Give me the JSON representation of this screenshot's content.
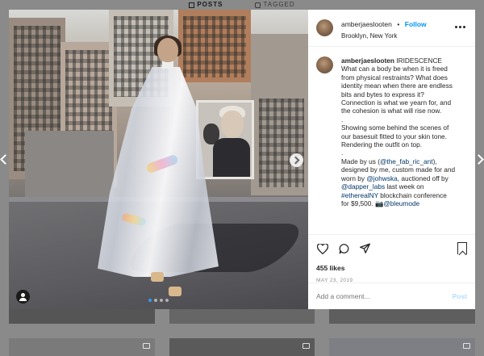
{
  "profile_tabs": [
    {
      "label": "POSTS",
      "icon": "grid-icon",
      "active": true
    },
    {
      "label": "TAGGED",
      "icon": "tagged-icon",
      "active": false
    }
  ],
  "post": {
    "username": "amberjaeslooten",
    "follow_label": "Follow",
    "separator": "•",
    "location": "Brooklyn, New York",
    "caption": {
      "username": "amberjaeslooten",
      "lines": [
        {
          "t": "text",
          "v": "IRIDESCENCE"
        },
        {
          "t": "text",
          "v": "What can a body be when it is freed"
        },
        {
          "t": "text",
          "v": "from physical restraints? What does"
        },
        {
          "t": "text",
          "v": "identity mean when there are endless"
        },
        {
          "t": "text",
          "v": "bits and bytes to express it?"
        },
        {
          "t": "text",
          "v": "Connection is what we yearn for, and"
        },
        {
          "t": "text",
          "v": "the cohesion is what will rise now."
        },
        {
          "t": "text",
          "v": "."
        },
        {
          "t": "text",
          "v": "Showing some behind the scenes of"
        },
        {
          "t": "text",
          "v": "our basesuit fitted to your skin tone."
        },
        {
          "t": "text",
          "v": "Rendering the outfit on top."
        },
        {
          "t": "text",
          "v": "."
        },
        {
          "t": "text",
          "v": "Made by us (@the_fab_ric_ant),"
        },
        {
          "t": "text",
          "v": "designed by me, custom made for and"
        },
        {
          "t": "text",
          "v": "worn by @johwska, auctioned off by"
        },
        {
          "t": "text",
          "v": "@dapper_labs last week on"
        },
        {
          "t": "text",
          "v": "#etherealNY blockchain conference"
        },
        {
          "t": "text",
          "v": "for $9,500. 📷@bleumode"
        }
      ]
    },
    "likes": "455 likes",
    "date": "MAY 23, 2019",
    "comment_placeholder": "Add a comment...",
    "post_label": "Post",
    "carousel": {
      "count": 4,
      "active_index": 0
    }
  },
  "colors": {
    "link": "#00376b",
    "follow": "#0095f6",
    "post_disabled": "#b2dffc",
    "carousel_active": "#3897f0"
  }
}
